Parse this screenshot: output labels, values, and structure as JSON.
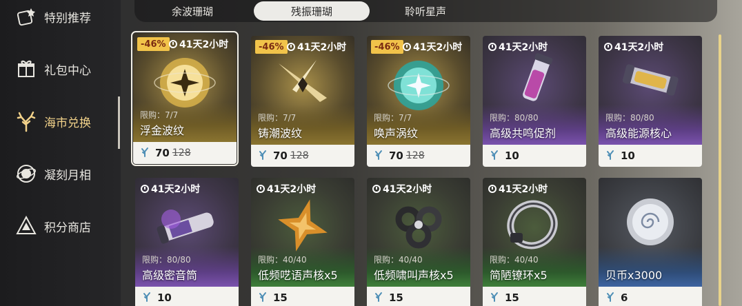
{
  "sidebar": {
    "items": [
      {
        "label": "特别推荐",
        "icon": "star-box-icon"
      },
      {
        "label": "礼包中心",
        "icon": "gift-icon"
      },
      {
        "label": "海市兑换",
        "icon": "coral-icon"
      },
      {
        "label": "凝刻月相",
        "icon": "moon-orb-icon"
      },
      {
        "label": "积分商店",
        "icon": "triangle-emblem-icon"
      }
    ],
    "active_index": 2
  },
  "tabs": [
    {
      "label": "余波珊瑚"
    },
    {
      "label": "残振珊瑚"
    },
    {
      "label": "聆听星声"
    }
  ],
  "active_tab_index": 1,
  "currency_icon": "coral-currency-icon",
  "cards": [
    {
      "name": "浮金波纹",
      "discount": "-46%",
      "timer": "41天2小时",
      "limit": "限购：7/7",
      "price": "70",
      "old_price": "128",
      "rarity": "gold",
      "art": "gold-orb"
    },
    {
      "name": "铸潮波纹",
      "discount": "-46%",
      "timer": "41天2小时",
      "limit": "限购：7/7",
      "price": "70",
      "old_price": "128",
      "rarity": "gold",
      "art": "gold-blade"
    },
    {
      "name": "唤声涡纹",
      "discount": "-46%",
      "timer": "41天2小时",
      "limit": "限购：7/7",
      "price": "70",
      "old_price": "128",
      "rarity": "gold",
      "art": "teal-orb"
    },
    {
      "name": "高级共鸣促剂",
      "discount": "",
      "timer": "41天2小时",
      "limit": "限购：80/80",
      "price": "10",
      "old_price": "",
      "rarity": "purple",
      "art": "vial"
    },
    {
      "name": "高级能源核心",
      "discount": "",
      "timer": "41天2小时",
      "limit": "限购：80/80",
      "price": "10",
      "old_price": "",
      "rarity": "purple",
      "art": "capsule"
    },
    {
      "name": "高级密音筒",
      "discount": "",
      "timer": "41天2小时",
      "limit": "限购：80/80",
      "price": "10",
      "old_price": "",
      "rarity": "purple",
      "art": "tube"
    },
    {
      "name": "低频呓语声核x5",
      "discount": "",
      "timer": "41天2小时",
      "limit": "限购：40/40",
      "price": "15",
      "old_price": "",
      "rarity": "green",
      "art": "star-core"
    },
    {
      "name": "低频啸叫声核x5",
      "discount": "",
      "timer": "41天2小时",
      "limit": "限购：40/40",
      "price": "15",
      "old_price": "",
      "rarity": "green",
      "art": "knot-core"
    },
    {
      "name": "简陋镣环x5",
      "discount": "",
      "timer": "41天2小时",
      "limit": "限购：40/40",
      "price": "15",
      "old_price": "",
      "rarity": "green",
      "art": "ring"
    },
    {
      "name": "贝币x3000",
      "discount": "",
      "timer": "",
      "limit": "",
      "price": "6",
      "old_price": "",
      "rarity": "blue",
      "art": "coin"
    }
  ]
}
